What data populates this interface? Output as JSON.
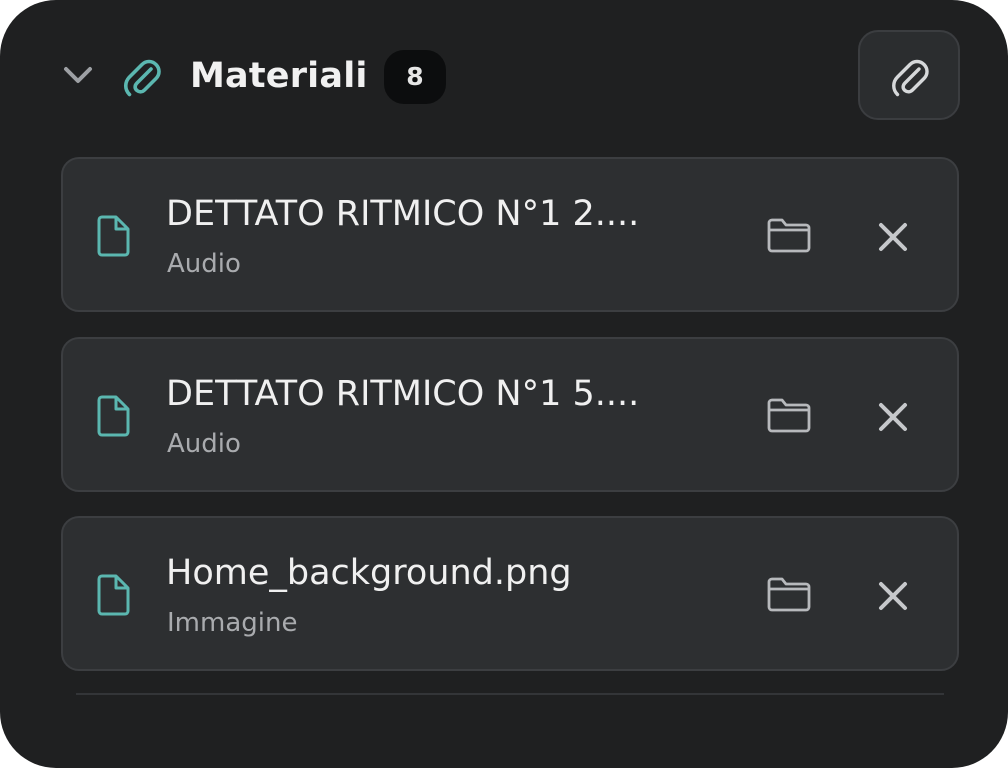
{
  "section": {
    "title": "Materiali",
    "count": "8",
    "icons": {
      "collapse": "chevron-down-icon",
      "section": "paperclip-icon",
      "attach": "paperclip-icon"
    }
  },
  "colors": {
    "panel_background": "#1f2021",
    "item_background": "#2d2f31",
    "accent_teal": "#5bb7b0",
    "text_primary": "#f0f0f0",
    "text_secondary": "#a9abae"
  },
  "materials": [
    {
      "name": "DETTATO RITMICO N°1 2....",
      "type": "Audio",
      "file_icon": "file-icon",
      "folder_icon": "folder-icon",
      "remove_icon": "close-icon"
    },
    {
      "name": "DETTATO RITMICO N°1 5....",
      "type": "Audio",
      "file_icon": "file-icon",
      "folder_icon": "folder-icon",
      "remove_icon": "close-icon"
    },
    {
      "name": "Home_background.png",
      "type": "Immagine",
      "file_icon": "file-icon",
      "folder_icon": "folder-icon",
      "remove_icon": "close-icon"
    }
  ]
}
